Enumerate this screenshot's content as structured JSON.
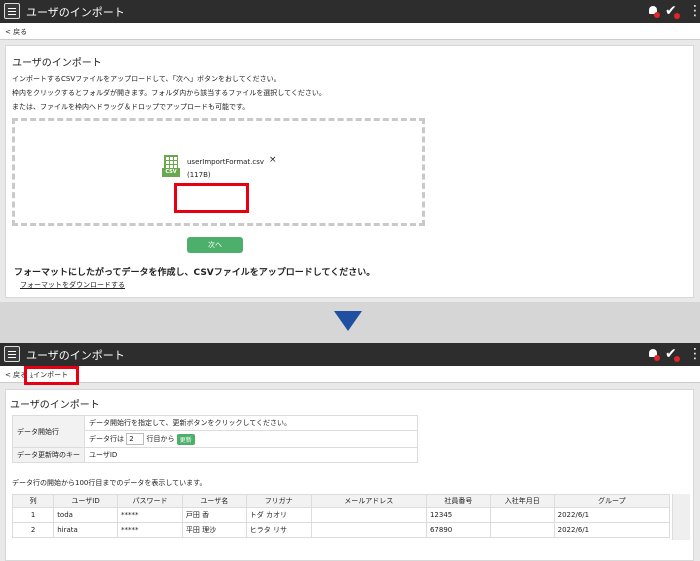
{
  "screen1": {
    "title": "ユーザのインポート",
    "back_label": "戻る",
    "heading": "ユーザのインポート",
    "instructions": [
      "インポートするCSVファイルをアップロードして、「次へ」ボタンをおしてください。",
      "枠内をクリックするとフォルダが開きます。フォルダ内から該当するファイルを選択してください。",
      "または、ファイルを枠内へドラッグ＆ドロップでアップロードも可能です。"
    ],
    "file": {
      "icon": "csv-file-icon",
      "icon_label": "CSV",
      "name": "userImportFormat.csv",
      "size": "(117B)",
      "remove": "×"
    },
    "next_button": "次へ",
    "format_text": "フォーマットにしたがってデータを作成し、CSVファイルをアップロードしてください。",
    "download_link": "フォーマットをダウンロードする"
  },
  "screen2": {
    "title": "ユーザのインポート",
    "back_label": "戻る",
    "import_label": "インポート",
    "heading": "ユーザのインポート",
    "settings": {
      "start_row_label": "データ開始行",
      "start_row_desc": "データ開始行を指定して、更新ボタンをクリックしてください。",
      "row_prefix": "データ行は",
      "row_value": "2",
      "row_suffix": "行目から",
      "update_button": "更新",
      "key_label": "データ更新時のキー",
      "key_value": "ユーザID"
    },
    "note": "データ行の開始から100行目までのデータを表示しています。",
    "table": {
      "headers": [
        "列",
        "ユーザID",
        "パスワード",
        "ユーザ名",
        "フリガナ",
        "メールアドレス",
        "社員番号",
        "入社年月日",
        "グループ"
      ],
      "rows": [
        [
          "1",
          "toda",
          "*****",
          "戸田 香",
          "トダ カオリ",
          "",
          "12345",
          "",
          "2022/6/1"
        ],
        [
          "2",
          "hirata",
          "*****",
          "平田 理沙",
          "ヒラタ リサ",
          "",
          "67890",
          "",
          "2022/6/1"
        ]
      ]
    }
  },
  "colors": {
    "topbar": "#2d2d2d",
    "accent_green": "#4caf6a",
    "highlight_red": "#e60012",
    "arrow_blue": "#1f4fa0",
    "badge_red": "#e0262a"
  },
  "icons": [
    "menu-icon",
    "bell-icon",
    "check-icon",
    "kebab-icon",
    "chevron-left-icon",
    "download-icon",
    "csv-file-icon",
    "close-icon",
    "arrow-down-icon"
  ]
}
